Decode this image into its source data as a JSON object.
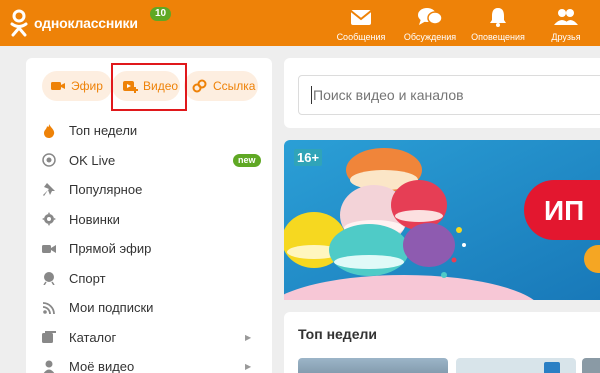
{
  "header": {
    "brand": "одноклассники",
    "badge": "10",
    "nav": [
      {
        "label": "Сообщения",
        "icon": "envelope-icon"
      },
      {
        "label": "Обсуждения",
        "icon": "chat-bubbles-icon"
      },
      {
        "label": "Оповещения",
        "icon": "bell-icon"
      },
      {
        "label": "Друзья",
        "icon": "people-icon"
      }
    ]
  },
  "sidebar": {
    "pills": [
      {
        "label": "Эфир",
        "icon": "camera-plus-icon"
      },
      {
        "label": "Видео",
        "icon": "video-plus-icon"
      },
      {
        "label": "Ссылка",
        "icon": "link-plus-icon"
      }
    ],
    "menu": [
      {
        "label": "Топ недели",
        "icon": "flame-icon"
      },
      {
        "label": "OK Live",
        "icon": "live-icon",
        "badge": "new"
      },
      {
        "label": "Популярное",
        "icon": "pin-icon"
      },
      {
        "label": "Новинки",
        "icon": "gear-badge-icon"
      },
      {
        "label": "Прямой эфир",
        "icon": "camera-icon"
      },
      {
        "label": "Спорт",
        "icon": "ball-icon"
      },
      {
        "label": "Мои подписки",
        "icon": "rss-icon"
      },
      {
        "label": "Каталог",
        "icon": "catalog-icon",
        "arrow": "▶"
      },
      {
        "label": "Моё видео",
        "icon": "person-icon",
        "arrow": "▶"
      }
    ]
  },
  "search": {
    "placeholder": "Поиск видео и каналов"
  },
  "banner": {
    "age": "16+"
  },
  "top_week": {
    "title": "Топ недели"
  },
  "colors": {
    "brand": "#ee8208",
    "new_badge": "#5fa824",
    "highlight": "#e0181b"
  }
}
